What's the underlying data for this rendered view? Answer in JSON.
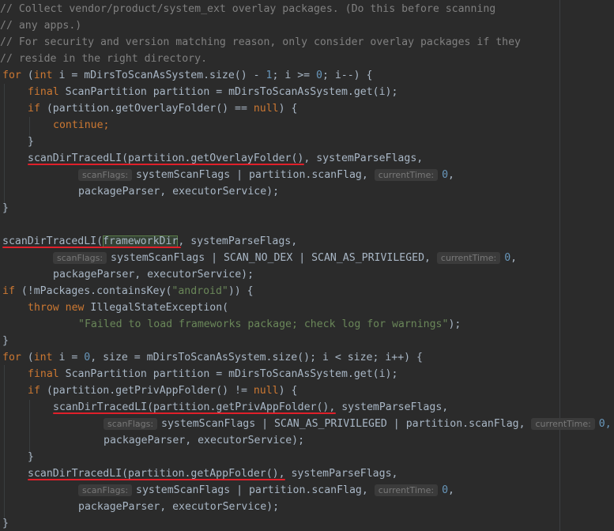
{
  "colors": {
    "background": "#2b2b2b",
    "keyword": "#cc7832",
    "number": "#6897bb",
    "comment": "#808080",
    "string": "#6a8759",
    "underline": "#e0202a",
    "highlight": "#344134"
  },
  "comments": {
    "c1": "// Collect vendor/product/system_ext overlay packages. (Do this before scanning",
    "c2": "// any apps.)",
    "c3": "// For security and version matching reason, only consider overlay packages if they",
    "c4": "// reside in the right directory."
  },
  "code": {
    "for1_kw": "for",
    "for1_a": " (",
    "for1_int": "int",
    "for1_b": " i = mDirsToScanAsSystem.size() - ",
    "for1_n1": "1",
    "for1_c": "; i >= ",
    "for1_n0": "0",
    "for1_d": "; i--) {",
    "final_kw": "final",
    "final_rest": " ScanPartition partition = mDirsToScanAsSystem.get(i);",
    "if1_kw": "if",
    "if1_a": " (partition.getOverlayFolder() == ",
    "null_kw": "null",
    "if1_b": ") {",
    "continue_kw": "continue;",
    "close_brace": "}",
    "scan1_call": "scanDirTracedLI(partition.getOverlayFolder()",
    "scan1_rest": ", systemParseFlags,",
    "hint_scanflags": "scanFlags:",
    "hint_currenttime": "currentTime:",
    "scan1_args": "systemScanFlags | partition.scanFlag, ",
    "zero": "0",
    "comma": ",",
    "pp_line": "packageParser, executorService);",
    "scan2_name": "scanDirTracedLI(",
    "scan2_hl": "frameworkDir",
    "scan2_rest": ", systemParseFlags,",
    "scan2_args": "systemScanFlags | SCAN_NO_DEX | SCAN_AS_PRIVILEGED, ",
    "if2_kw": "if",
    "if2_rest": " (!mPackages.containsKey(",
    "if2_str": "\"android\"",
    "if2_end": ")) {",
    "throw_kw": "throw new",
    "throw_rest": " IllegalStateException(",
    "fail_str": "\"Failed to load frameworks package; check log for warnings\"",
    "fail_end": ");",
    "for2_kw": "for",
    "for2_a": " (",
    "for2_int": "int",
    "for2_b": " i = ",
    "for2_n0": "0",
    "for2_c": ", size = mDirsToScanAsSystem.size(); i < size; i++) {",
    "if3_a": " (partition.getPrivAppFolder() != ",
    "scan3_call": "scanDirTracedLI(partition.getPrivAppFolder()",
    "scan3_args": "systemScanFlags | SCAN_AS_PRIVILEGED | partition.scanFlag, ",
    "zero_comma": "0,",
    "scan4_call": "scanDirTracedLI(partition.getAppFolder()",
    "scan4_rest": ", systemParseFlags,"
  }
}
